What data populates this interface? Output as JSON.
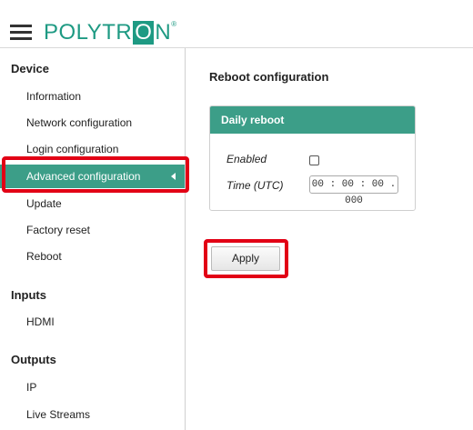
{
  "header": {
    "logo_pre": "POLYTR",
    "logo_boxed": "O",
    "logo_post": "N",
    "logo_mark": "®",
    "brand_color": "#1e9a83"
  },
  "sidebar": {
    "sections": [
      {
        "title": "Device",
        "items": [
          {
            "label": "Information"
          },
          {
            "label": "Network configuration"
          },
          {
            "label": "Login configuration"
          },
          {
            "label": "Advanced configuration",
            "active": true
          },
          {
            "label": "Update"
          },
          {
            "label": "Factory reset"
          },
          {
            "label": "Reboot"
          }
        ]
      },
      {
        "title": "Inputs",
        "items": [
          {
            "label": "HDMI"
          }
        ]
      },
      {
        "title": "Outputs",
        "items": [
          {
            "label": "IP"
          },
          {
            "label": "Live Streams"
          }
        ]
      }
    ],
    "active_color": "#3c9e88"
  },
  "main": {
    "title": "Reboot configuration",
    "panel": {
      "title": "Daily reboot",
      "enabled_label": "Enabled",
      "enabled_checked": false,
      "time_label": "Time (UTC)",
      "time_value": "00 : 00 : 00 . 000"
    },
    "apply_label": "Apply"
  },
  "annotations": {
    "highlight_color": "#e20015"
  }
}
